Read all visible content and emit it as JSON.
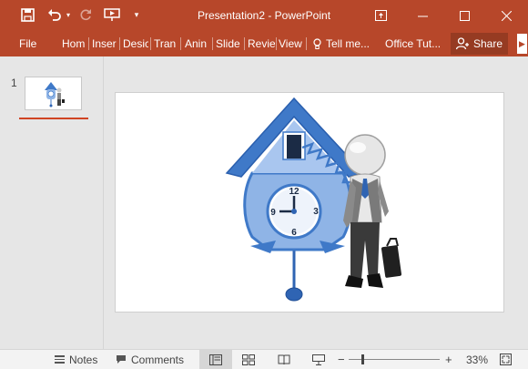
{
  "window": {
    "title": "Presentation2 - PowerPoint"
  },
  "qat": {
    "save_icon": "save-icon",
    "undo_icon": "undo-icon",
    "redo_icon": "redo-icon",
    "present_icon": "start-from-beginning-icon",
    "customize_icon": "customize-qat-icon"
  },
  "window_controls": {
    "ribbon_display_icon": "ribbon-display-options-icon",
    "minimize_icon": "minimize-icon",
    "maximize_icon": "maximize-icon",
    "close_icon": "close-icon"
  },
  "ribbon": {
    "tabs": [
      {
        "label": "File"
      },
      {
        "label": "Hom"
      },
      {
        "label": "Inser"
      },
      {
        "label": "Desic"
      },
      {
        "label": "Tran"
      },
      {
        "label": "Anin"
      },
      {
        "label": "Slide"
      },
      {
        "label": "Revie"
      },
      {
        "label": "View"
      }
    ],
    "tell_me": "Tell me...",
    "office_tut": "Office Tut...",
    "share": "Share"
  },
  "thumbnails": [
    {
      "number": "1"
    }
  ],
  "statusbar": {
    "notes": "Notes",
    "comments": "Comments",
    "zoom_percent": "33%",
    "zoom_minus": "−",
    "zoom_plus": "+",
    "zoom_level": 0.33
  },
  "colors": {
    "accent": "#b7472a",
    "share_bg": "#963b22",
    "clock_blue": "#3f79c8"
  }
}
